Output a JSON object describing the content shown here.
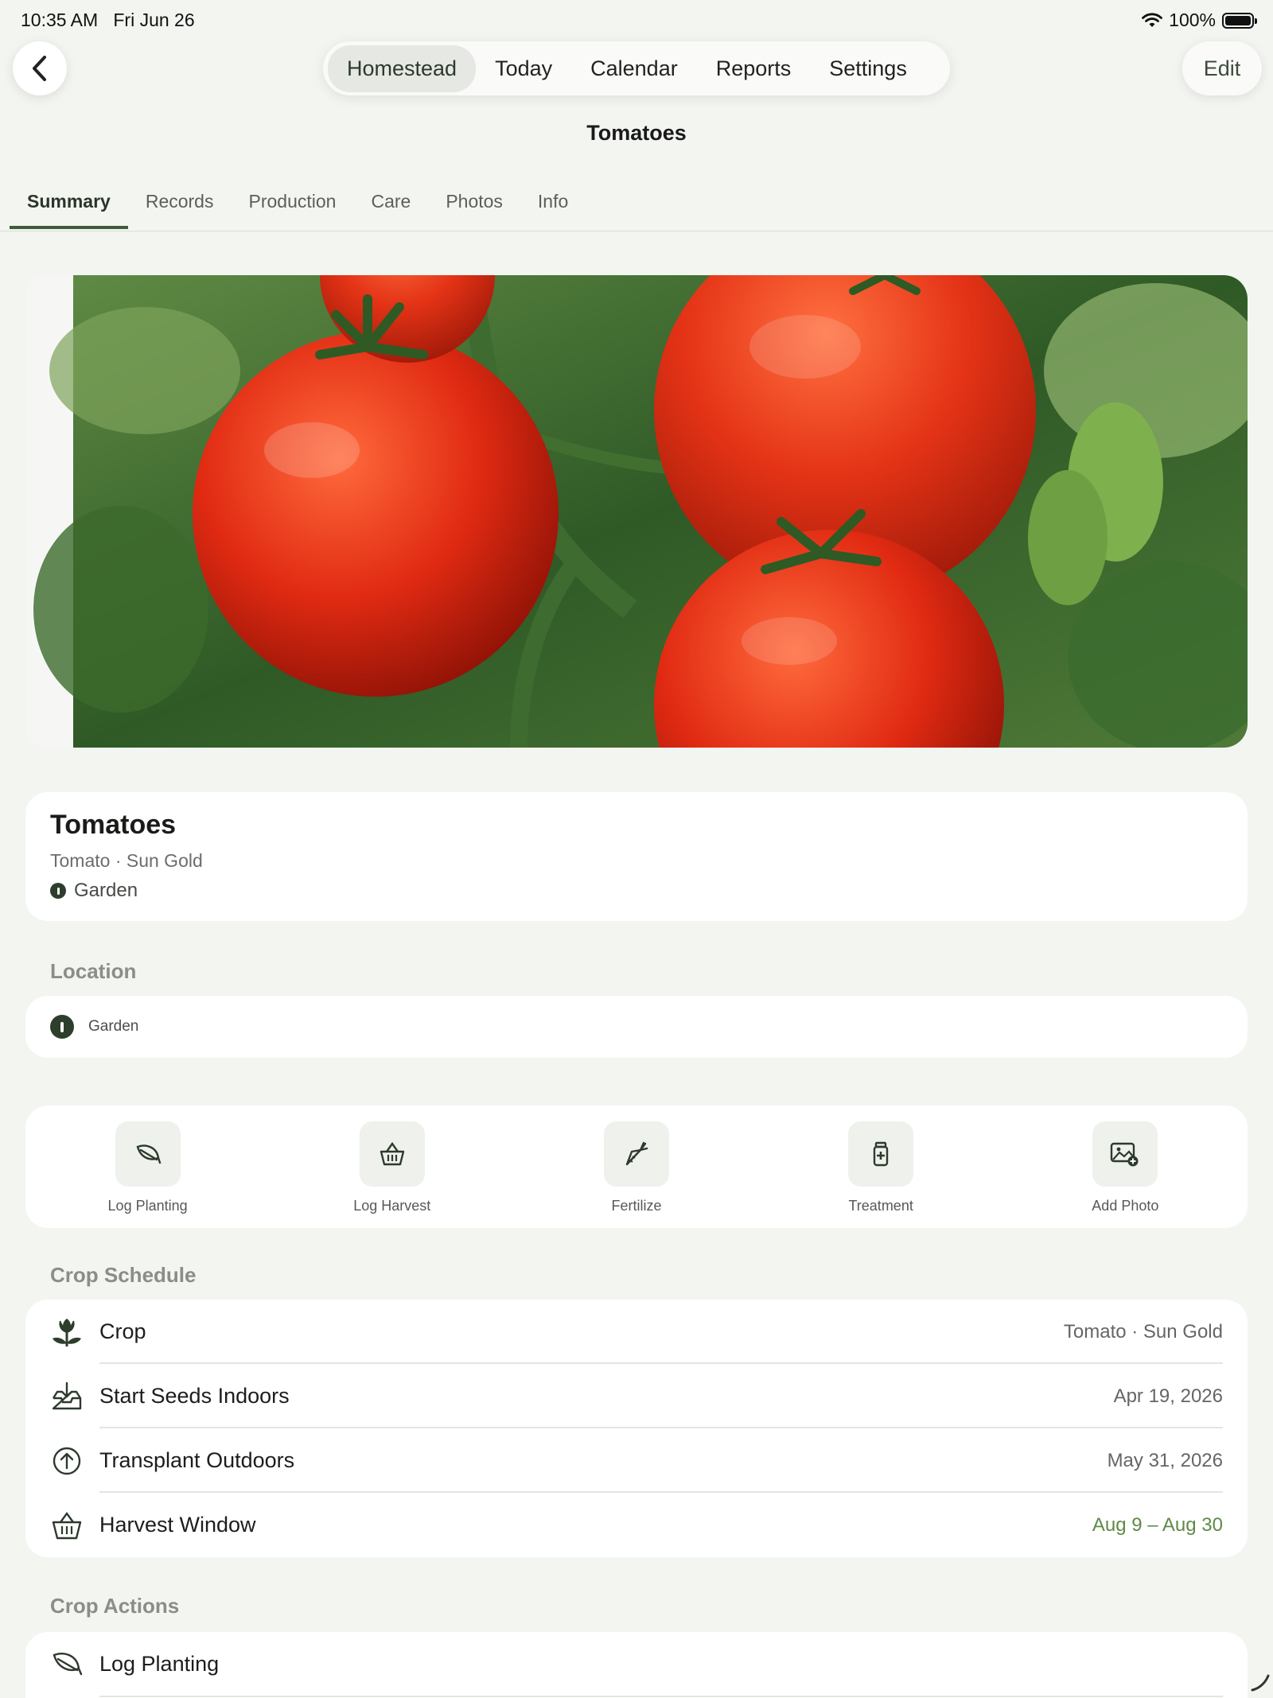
{
  "status": {
    "time": "10:35 AM",
    "date": "Fri Jun 26",
    "battery": "100%"
  },
  "nav": {
    "items": [
      {
        "label": "Homestead",
        "active": true
      },
      {
        "label": "Today",
        "active": false
      },
      {
        "label": "Calendar",
        "active": false
      },
      {
        "label": "Reports",
        "active": false
      },
      {
        "label": "Settings",
        "active": false
      }
    ],
    "edit_label": "Edit"
  },
  "page_title": "Tomatoes",
  "tabs": [
    {
      "label": "Summary",
      "active": true
    },
    {
      "label": "Records",
      "active": false
    },
    {
      "label": "Production",
      "active": false
    },
    {
      "label": "Care",
      "active": false
    },
    {
      "label": "Photos",
      "active": false
    },
    {
      "label": "Info",
      "active": false
    }
  ],
  "crop": {
    "name": "Tomatoes",
    "variety": "Tomato · Sun Gold",
    "location": "Garden"
  },
  "location_section": {
    "label": "Location",
    "value": "Garden"
  },
  "quick_actions": [
    {
      "label": "Log Planting",
      "icon": "leaf-icon"
    },
    {
      "label": "Log Harvest",
      "icon": "basket-icon"
    },
    {
      "label": "Fertilize",
      "icon": "carrot-icon"
    },
    {
      "label": "Treatment",
      "icon": "medicine-bottle-icon"
    },
    {
      "label": "Add Photo",
      "icon": "add-photo-icon"
    }
  ],
  "schedule": {
    "label": "Crop Schedule",
    "rows": [
      {
        "label": "Crop",
        "value": "Tomato · Sun Gold",
        "icon": "sprout-icon"
      },
      {
        "label": "Start Seeds Indoors",
        "value": "Apr 19, 2026",
        "icon": "tray-download-icon"
      },
      {
        "label": "Transplant Outdoors",
        "value": "May 31, 2026",
        "icon": "arrow-up-circle-icon"
      },
      {
        "label": "Harvest Window",
        "value": "Aug 9 – Aug 30",
        "icon": "basket-icon",
        "accent": "#5d8a46"
      }
    ]
  },
  "crop_actions": {
    "label": "Crop Actions",
    "rows": [
      {
        "label": "Log Planting",
        "icon": "leaf-icon"
      }
    ]
  },
  "colors": {
    "accent": "#3d5c38",
    "background": "#f3f5f1",
    "harvest_green": "#5d8a46"
  }
}
